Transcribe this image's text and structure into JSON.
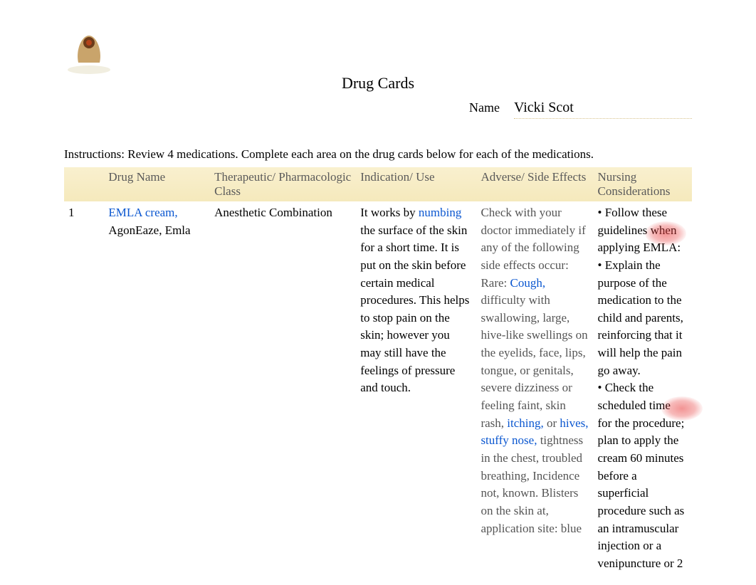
{
  "header": {
    "title": "Drug Cards",
    "name_label": "Name",
    "name_value": "Vicki Scot"
  },
  "instructions": "Instructions: Review 4 medications.   Complete each area on the drug cards below for each of the medications.",
  "table": {
    "columns": {
      "num": "",
      "drug": "Drug Name",
      "class": "Therapeutic/ Pharmacologic Class",
      "indication": "Indication/ Use",
      "adverse": "Adverse/ Side Effects",
      "nursing": "Nursing Considerations"
    },
    "rows": [
      {
        "num": "1",
        "drug_link": "EMLA cream,",
        "drug_rest": " AgonEaze, Emla",
        "class": "Anesthetic Combination",
        "indication_pre": "It works by ",
        "indication_link": "numbing",
        "indication_post": " the surface of the skin for a short time. It is put on the skin before certain medical procedures. This helps to stop pain on the skin; however you may still have the feelings of pressure and touch.",
        "adverse": {
          "lead": "Check with your doctor immediately if any of the following side effects occur: Rare: ",
          "link1": "Cough,",
          "mid1": " difficulty with swallowing, large, hive-like swellings on the eyelids, face, lips, tongue, or genitals, severe dizziness or feeling faint, skin rash,  ",
          "link2": "itching,",
          "mid2": " or ",
          "link3": "hives, stuffy nose,",
          "tail": " tightness in the chest, troubled breathing, Incidence not, known. Blisters on the skin at, application site: blue"
        },
        "nursing": "• Follow these guidelines when applying EMLA:\n• Explain the purpose of the medication to the child and parents, reinforcing that it will help the pain go away.\n• Check the scheduled time for the procedure; plan to apply the cream 60 minutes before a superficial procedure such as an intramuscular injection or a venipuncture or 2"
      }
    ]
  }
}
